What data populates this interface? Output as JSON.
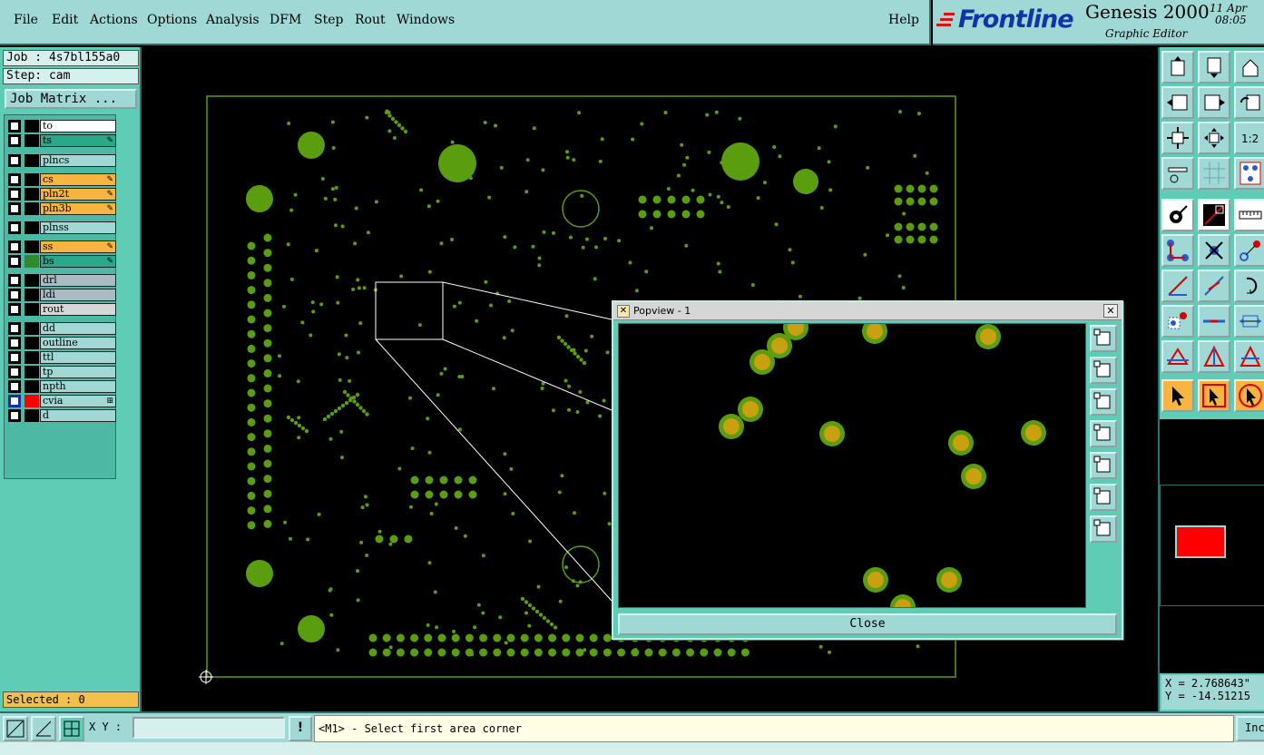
{
  "menubar": {
    "items": [
      "File",
      "Edit",
      "Actions",
      "Options",
      "Analysis",
      "DFM",
      "Step",
      "Rout",
      "Windows"
    ],
    "help": "Help"
  },
  "brand": {
    "logo": "Frontline",
    "title": "Genesis 2000",
    "subtitle": "Graphic Editor",
    "date": "11 Apr",
    "time": "08:05"
  },
  "leftpanel": {
    "job": "Job : 4s7bl155a0",
    "step": "Step: cam",
    "job_matrix": "Job Matrix ...",
    "layers": [
      {
        "name": "to",
        "bg": "#ffffff",
        "swatch": "#000000",
        "mark": ""
      },
      {
        "name": "ts",
        "bg": "#2aa98a",
        "swatch": "#000000",
        "mark": "✎"
      },
      {
        "name": "plncs",
        "bg": "#9fd8d4",
        "swatch": "#000000",
        "mark": ""
      },
      {
        "name": "cs",
        "bg": "#f7b440",
        "swatch": "#000000",
        "mark": "✎"
      },
      {
        "name": "pln2t",
        "bg": "#f7b440",
        "swatch": "#000000",
        "mark": "✎"
      },
      {
        "name": "pln3b",
        "bg": "#f7b440",
        "swatch": "#000000",
        "mark": "✎"
      },
      {
        "name": "plnss",
        "bg": "#9fd8d4",
        "swatch": "#000000",
        "mark": ""
      },
      {
        "name": "ss",
        "bg": "#f7b440",
        "swatch": "#000000",
        "mark": "✎"
      },
      {
        "name": "bs",
        "bg": "#2aa98a",
        "swatch": "#2e8b2e",
        "mark": "✎"
      },
      {
        "name": "drl",
        "bg": "#a9bcc4",
        "swatch": "#000000",
        "mark": ""
      },
      {
        "name": "ldi",
        "bg": "#a9bcc4",
        "swatch": "#000000",
        "mark": ""
      },
      {
        "name": "rout",
        "bg": "#d6d6d6",
        "swatch": "#000000",
        "mark": ""
      },
      {
        "name": "dd",
        "bg": "#9fd8d4",
        "swatch": "#000000",
        "mark": ""
      },
      {
        "name": "outline",
        "bg": "#9fd8d4",
        "swatch": "#000000",
        "mark": ""
      },
      {
        "name": "ttl",
        "bg": "#9fd8d4",
        "swatch": "#000000",
        "mark": ""
      },
      {
        "name": "tp",
        "bg": "#9fd8d4",
        "swatch": "#000000",
        "mark": ""
      },
      {
        "name": "npth",
        "bg": "#9fd8d4",
        "swatch": "#000000",
        "mark": ""
      },
      {
        "name": "cvia",
        "bg": "#9fd8d4",
        "swatch": "#ff0000",
        "mark": "⊞",
        "active": true
      },
      {
        "name": "d",
        "bg": "#9fd8d4",
        "swatch": "#000000",
        "mark": ""
      }
    ],
    "selected": "Selected : 0"
  },
  "popview": {
    "title": "Popview - 1",
    "close": "Close"
  },
  "coords": {
    "x": "X = 2.768643\"",
    "y": "Y = -14.51215"
  },
  "statusbar": {
    "xy_label": "X Y :",
    "xy_value": "",
    "bang": "!",
    "prompt": "<M1> - Select first area corner",
    "inc": "Inc"
  },
  "colors": {
    "panel": "#5fcdb6",
    "panel_light": "#9fd8d4",
    "pad": "#5a9e10",
    "pad_ring": "#c8a010",
    "active_layer": "#ff0000"
  },
  "icons": {
    "menu_brand": "frontline-logo",
    "popview_window": "x-window-icon",
    "popview_close": "close-icon"
  }
}
